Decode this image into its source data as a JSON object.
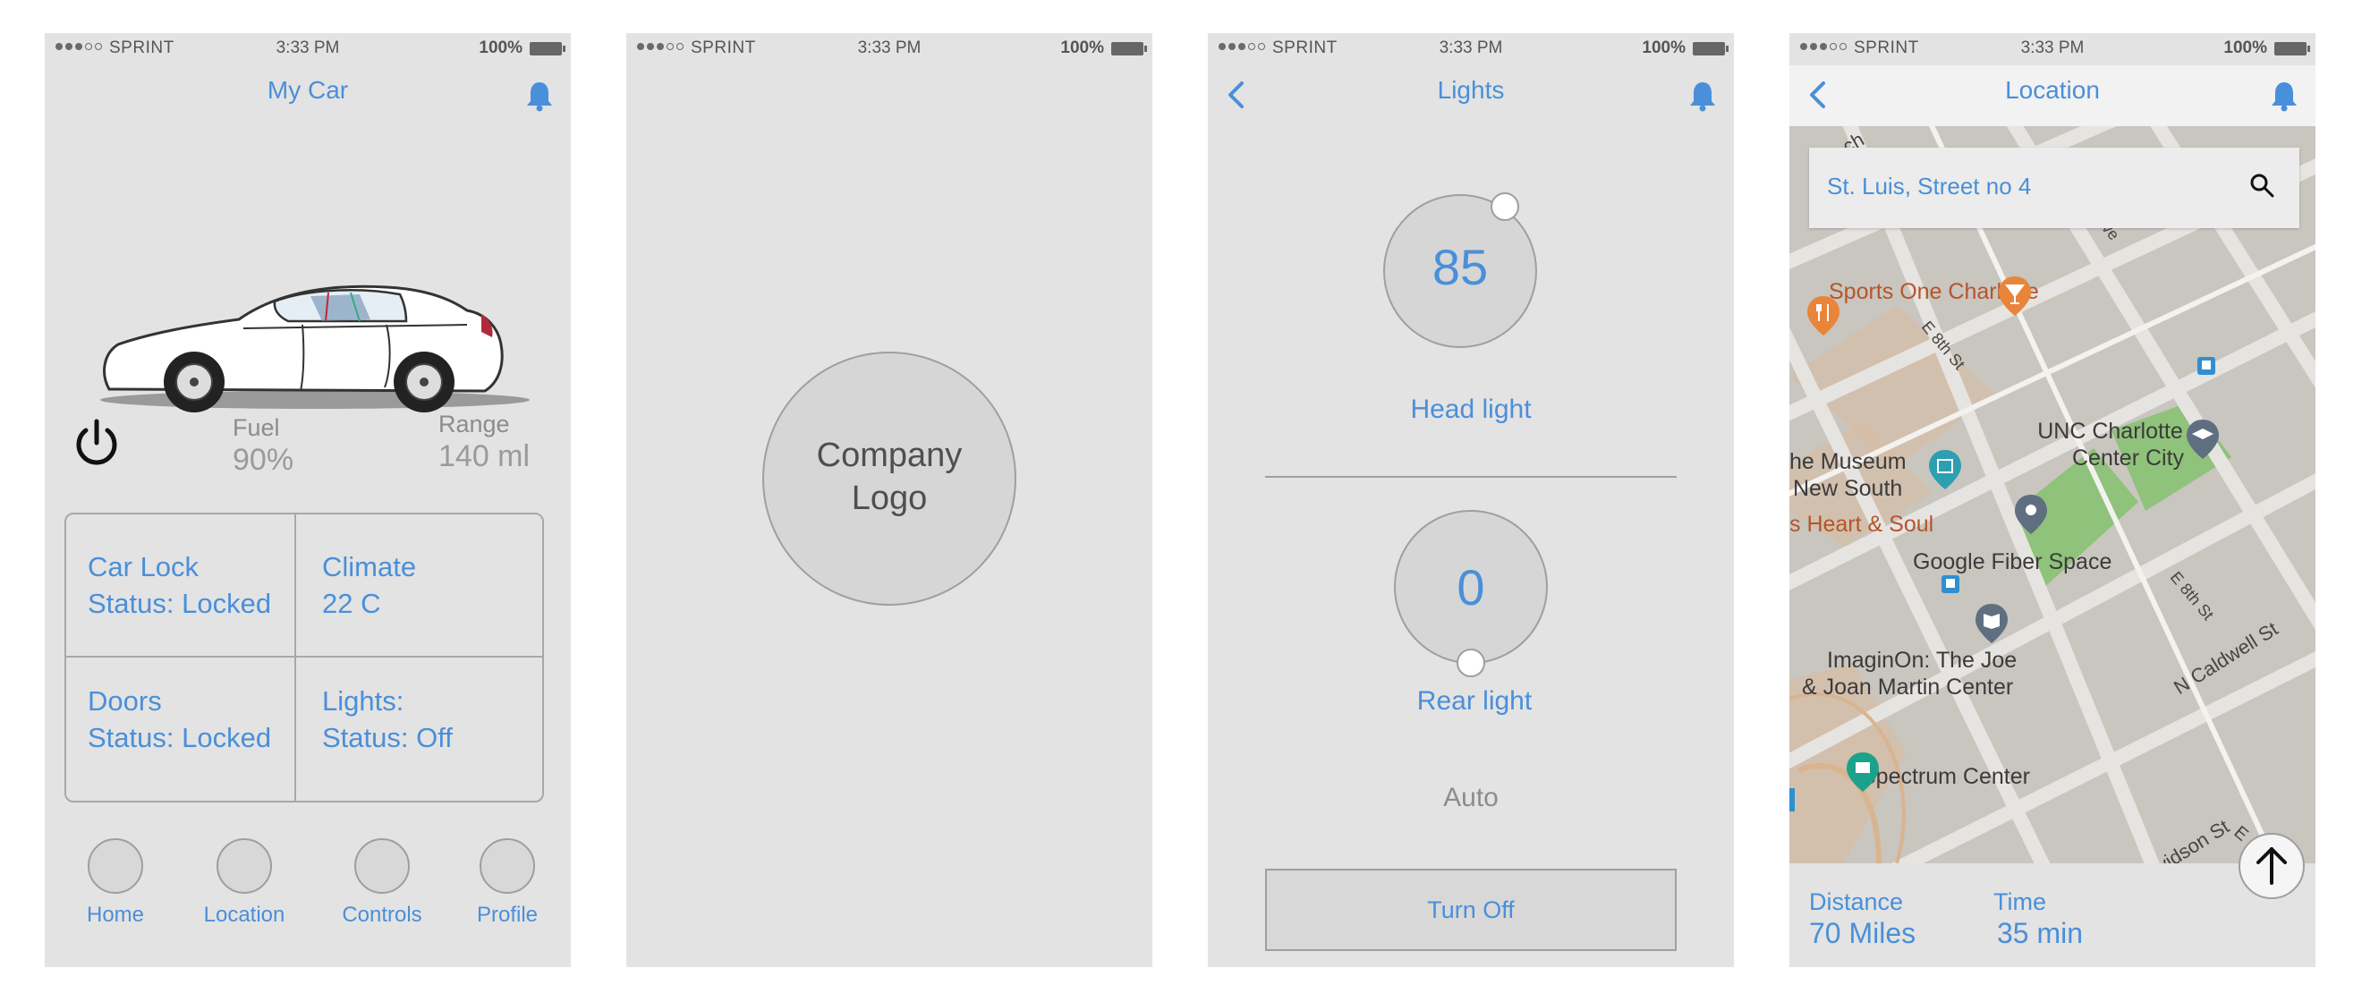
{
  "status_bar": {
    "carrier": "SPRINT",
    "time": "3:33 PM",
    "battery": "100%"
  },
  "screen1": {
    "title": "My Car",
    "fuel": {
      "label": "Fuel",
      "value": "90%"
    },
    "range": {
      "label": "Range",
      "value": "140 ml"
    },
    "tiles": [
      {
        "line1": "Car Lock",
        "line2": "Status: Locked"
      },
      {
        "line1": "Climate",
        "line2": "22 C"
      },
      {
        "line1": "Doors",
        "line2": "Status: Locked"
      },
      {
        "line1": "Lights:",
        "line2": "Status: Off"
      }
    ],
    "tabs": [
      {
        "label": "Home"
      },
      {
        "label": "Location"
      },
      {
        "label": "Controls"
      },
      {
        "label": "Profile"
      }
    ],
    "colors": {
      "accent": "#4a8fd9",
      "background": "#e3e3e3"
    }
  },
  "screen2": {
    "logo_line1": "Company",
    "logo_line2": "Logo"
  },
  "screen3": {
    "title": "Lights",
    "head_light": {
      "value": "85",
      "label": "Head light"
    },
    "rear_light": {
      "value": "0",
      "label": "Rear light"
    },
    "auto_label": "Auto",
    "turn_off_label": "Turn Off"
  },
  "screen4": {
    "title": "Location",
    "search_value": "St. Luis, Street no 4",
    "map_labels": {
      "sports": "Sports One Charlotte",
      "unc1": "UNC Charlotte",
      "unc2": "Center City",
      "museum1": "he Museum",
      "museum2": "New South",
      "heart": "s Heart & Soul",
      "fiber": "Google Fiber Space",
      "imagin1": "ImaginOn: The Joe",
      "imagin2": "& Joan Martin Center",
      "spectrum": "Spectrum Center",
      "e8th_a": "E 8th St",
      "e8th_b": "E 8th St",
      "caldwell": "N Caldwell St",
      "ave": "Ave",
      "ch": "ch",
      "vidson": "vidson St",
      "e_short": "E"
    },
    "distance": {
      "label": "Distance",
      "value": "70 Miles"
    },
    "time": {
      "label": "Time",
      "value": "35 min"
    }
  }
}
